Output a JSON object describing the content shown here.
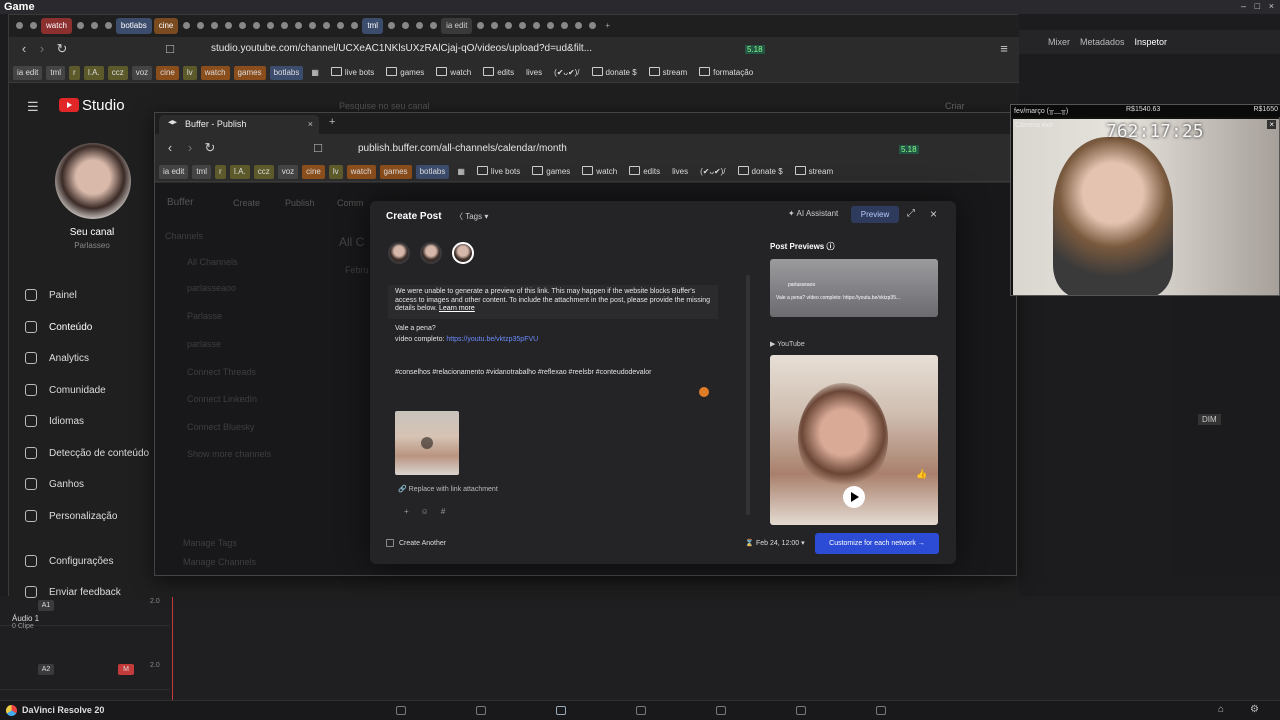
{
  "resolve": {
    "window_title": "Game",
    "toolbar": [
      "Mixer",
      "Metadados",
      "Inspetor"
    ],
    "app_name": "DaVinci Resolve 20",
    "tracks": [
      {
        "id": "A1",
        "name": "Áudio 1",
        "clips": "0 Clipe",
        "level": "2.0"
      },
      {
        "id": "A2",
        "name": "",
        "clips": "",
        "level": "2.0"
      }
    ],
    "dim_label": "DIM"
  },
  "yt_browser": {
    "tabs": [
      "watch",
      "botlabs",
      "cine",
      "tml",
      "ia edit"
    ],
    "url": "studio.youtube.com/channel/UCXeAC1NKlsUXzRAlCjaj-qO/videos/upload?d=ud&filt...",
    "bookmarks": [
      "ia edit",
      "tml",
      "r",
      "I.A.",
      "ccz",
      "voz",
      "cine",
      "lv",
      "watch",
      "games",
      "botlabs"
    ],
    "bookmark_folders": [
      "live bots",
      "games",
      "watch",
      "edits",
      "lives",
      "(✔ᴗ✔)/",
      "donate $",
      "stream",
      "formatação"
    ],
    "badge": "5.18"
  },
  "studio": {
    "logo": "Studio",
    "search_placeholder": "Pesquise no seu canal",
    "create_label": "Criar",
    "channel_name": "Seu canal",
    "channel_handle": "Parlasseo",
    "nav": [
      "Painel",
      "Conteúdo",
      "Analytics",
      "Comunidade",
      "Idiomas",
      "Detecção de conteúdo",
      "Ganhos",
      "Personalização"
    ],
    "nav_bottom": [
      "Configurações",
      "Enviar feedback"
    ]
  },
  "buffer_browser": {
    "tab_title": "Buffer - Publish",
    "url": "publish.buffer.com/all-channels/calendar/month",
    "bookmarks": [
      "ia edit",
      "tml",
      "r",
      "I.A.",
      "ccz",
      "voz",
      "cine",
      "lv",
      "watch",
      "games",
      "botlabs"
    ],
    "bookmark_folders": [
      "live bots",
      "games",
      "watch",
      "edits",
      "lives",
      "(✔ᴗ✔)/",
      "donate $",
      "stream"
    ],
    "badge": "5.18"
  },
  "buffer_bg": {
    "brand": "Buffer",
    "nav": [
      "Create",
      "Publish",
      "Comm"
    ],
    "channels_title": "Channels",
    "all_channels": "All Channels",
    "channel_list": [
      "parlasseaoo",
      "Parlasse",
      "parlasse"
    ],
    "connect": [
      "Connect Threads",
      "Connect LinkedIn",
      "Connect Bluesky"
    ],
    "show_more": "Show more channels",
    "manage": [
      "Manage Tags",
      "Manage Channels"
    ],
    "heading": "All C",
    "month_label": "Febru"
  },
  "modal": {
    "title": "Create Post",
    "tags_label": "Tags",
    "ai_label": "AI Assistant",
    "preview_label": "Preview",
    "warning": "We were unable to generate a preview of this link. This may happen if the website blocks Buffer's access to images and other content. To include the attachment in the post, please provide the missing details below.",
    "learn_more": "Learn more",
    "post_line1": "Vale a pena?",
    "post_line2_prefix": "vídeo completo: ",
    "post_link": "https://youtu.be/vktzp35pFVU",
    "hashtags": "#conselhos #relacionamento #vidanotrabalho #reflexao #reelsbr #conteudodevalor",
    "replace_label": "Replace with link attachment",
    "previews_title": "Post Previews",
    "preview_caption": "Vale a pena? vídeo completo: https://youtu.be/vktzp35...",
    "preview_account": "parlasseaoo",
    "youtube_label": "YouTube",
    "create_another": "Create Another",
    "date_label": "Feb 24, 12:00",
    "customize_label": "Customize for each network"
  },
  "camera": {
    "header_left": "fev/março (╥﹏╥)",
    "header_mid": "R$1540.63",
    "header_right": "R$1650",
    "label": "Câmera exe",
    "timer": "762:17:25"
  },
  "colors": {
    "accent_blue": "#2c4cd6",
    "yt_red": "#e02626",
    "link_blue": "#6b8cff"
  }
}
